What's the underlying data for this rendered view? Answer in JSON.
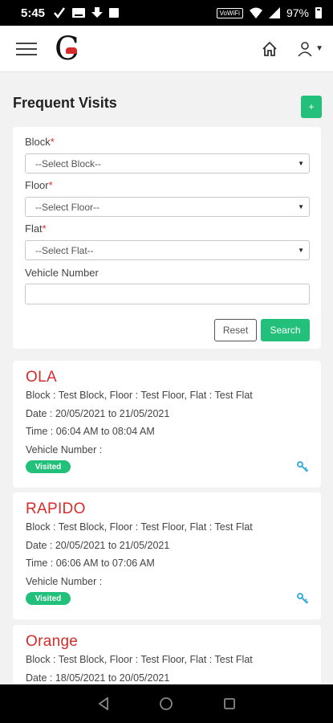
{
  "status_bar": {
    "time": "5:45",
    "battery": "97%",
    "network_badge": "VoWiFi"
  },
  "header": {
    "logo_letter": "C"
  },
  "page": {
    "title": "Frequent Visits",
    "add_label": "+"
  },
  "form": {
    "block_label": "Block",
    "block_placeholder": "--Select Block--",
    "floor_label": "Floor",
    "floor_placeholder": "--Select Floor--",
    "flat_label": "Flat",
    "flat_placeholder": "--Select Flat--",
    "required_mark": "*",
    "vehicle_label": "Vehicle Number",
    "vehicle_value": "",
    "reset_label": "Reset",
    "search_label": "Search"
  },
  "visits": [
    {
      "name": "OLA",
      "location": "Block : Test Block, Floor : Test Floor, Flat : Test Flat",
      "date": "Date : 20/05/2021 to 21/05/2021",
      "time": "Time : 06:04 AM to 08:04 AM",
      "vehicle": "Vehicle Number :",
      "status": "Visited"
    },
    {
      "name": "RAPIDO",
      "location": "Block : Test Block, Floor : Test Floor, Flat : Test Flat",
      "date": "Date : 20/05/2021 to 21/05/2021",
      "time": "Time : 06:06 AM to 07:06 AM",
      "vehicle": "Vehicle Number :",
      "status": "Visited"
    },
    {
      "name": "Orange",
      "location": "Block : Test Block, Floor : Test Floor, Flat : Test Flat",
      "date": "Date : 18/05/2021 to 20/05/2021"
    }
  ],
  "colors": {
    "accent": "#22c07a",
    "brand_red": "#d62b2b",
    "link_blue": "#2aa8d6"
  },
  "icons": [
    "hamburger-icon",
    "home-icon",
    "user-icon",
    "key-icon",
    "back-icon",
    "home-circle-icon",
    "recents-icon"
  ]
}
